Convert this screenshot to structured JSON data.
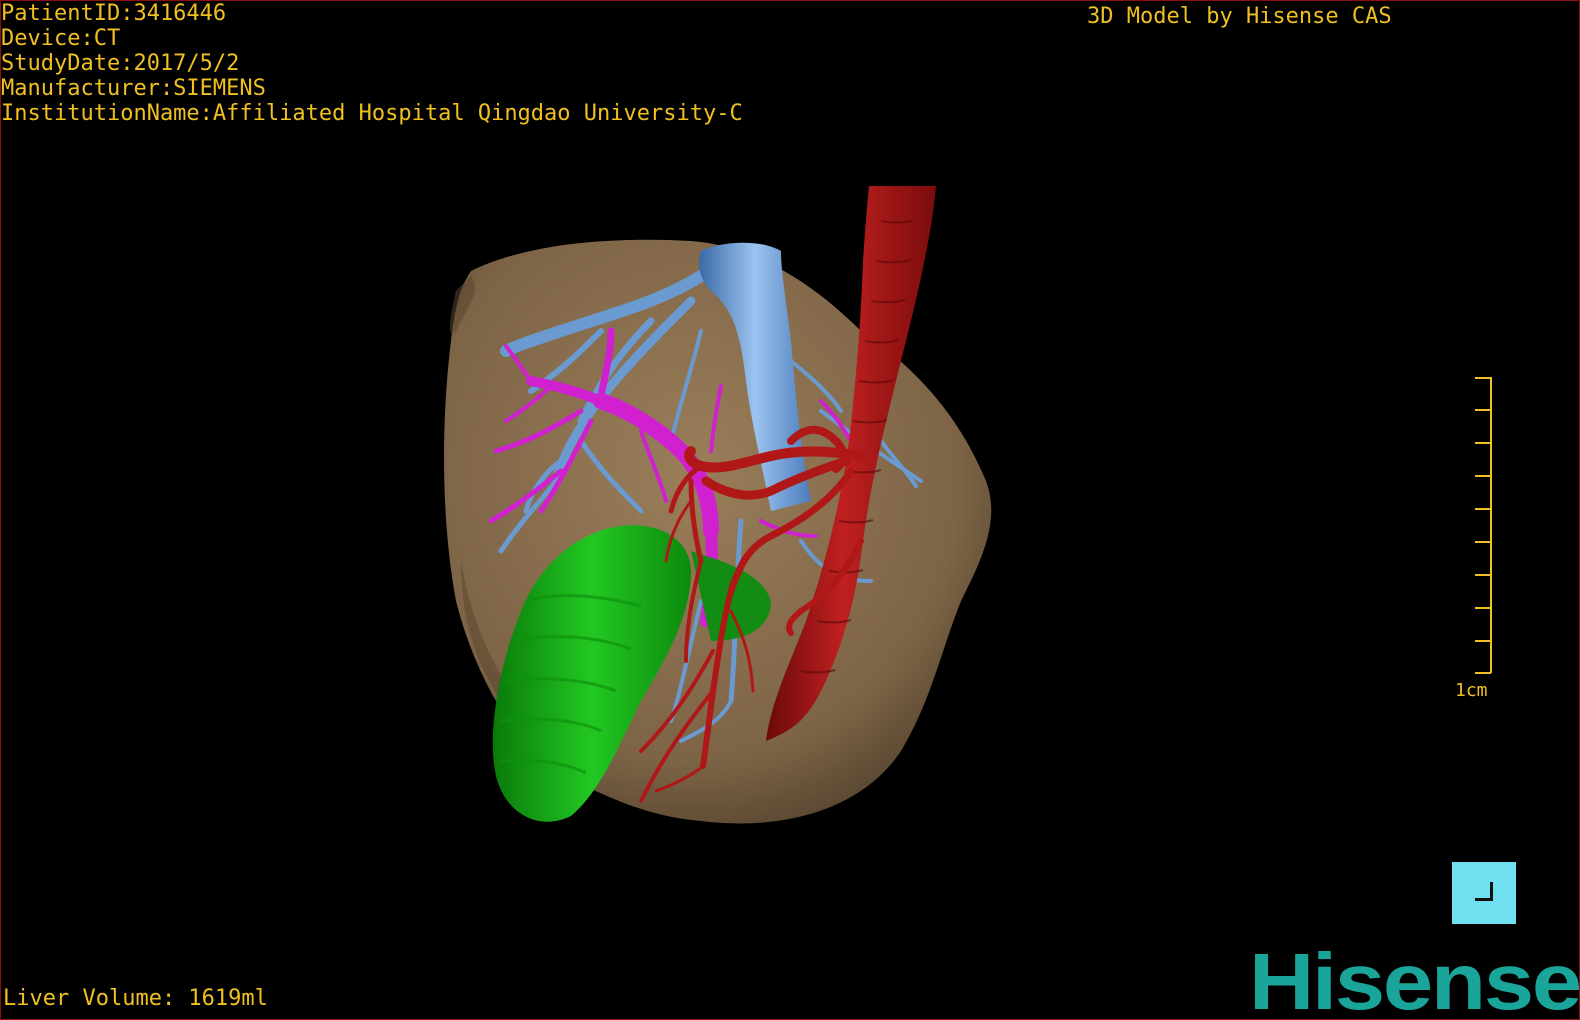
{
  "overlay": {
    "patient_id": "PatientID:3416446",
    "device": "Device:CT",
    "study_date": "StudyDate:2017/5/2",
    "manufacturer": "Manufacturer:SIEMENS",
    "institution": "InstitutionName:Affiliated Hospital Qingdao University-C",
    "credit": "3D Model by Hisense CAS",
    "liver_volume": "Liver Volume: 1619ml"
  },
  "scale": {
    "label": "1cm"
  },
  "logo": {
    "text": "Hisense"
  },
  "colors": {
    "overlay_text": "#f0c020",
    "liver": "#8a7050",
    "portal_vein": "#6a9ad0",
    "hepatic_vein": "#d020d0",
    "artery": "#b01818",
    "gallbladder": "#18b018",
    "logo": "#1aa59a",
    "corner_button": "#6fe0f0"
  },
  "icons": {
    "corner_button": "corner-bracket-icon"
  }
}
